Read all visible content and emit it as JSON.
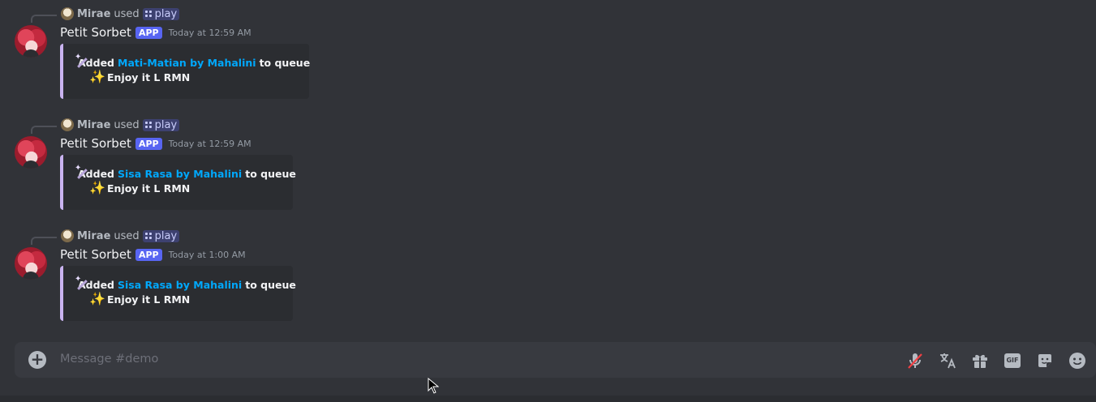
{
  "messages": [
    {
      "reply": {
        "user": "Mirae",
        "verb": "used",
        "command": "play"
      },
      "author": "Petit Sorbet",
      "badge": "APP",
      "timestamp": "Today at 12:59 AM",
      "embed": {
        "added": "Added",
        "track": "Mati-Matian by Mahalini",
        "suffix": "to queue",
        "line2": "Enjoy it L RMN"
      }
    },
    {
      "reply": {
        "user": "Mirae",
        "verb": "used",
        "command": "play"
      },
      "author": "Petit Sorbet",
      "badge": "APP",
      "timestamp": "Today at 12:59 AM",
      "embed": {
        "added": "Added",
        "track": "Sisa Rasa by Mahalini",
        "suffix": "to queue",
        "line2": "Enjoy it L RMN"
      }
    },
    {
      "reply": {
        "user": "Mirae",
        "verb": "used",
        "command": "play"
      },
      "author": "Petit Sorbet",
      "badge": "APP",
      "timestamp": "Today at 1:00 AM",
      "embed": {
        "added": "Added",
        "track": "Sisa Rasa by Mahalini",
        "suffix": "to queue",
        "line2": "Enjoy it L RMN"
      }
    }
  ],
  "composer": {
    "placeholder": "Message #demo",
    "gif_label": "GIF",
    "icons": [
      "plus-icon",
      "voice-muted-icon",
      "translate-icon",
      "gift-icon",
      "gif-icon",
      "sticker-icon",
      "emoji-icon"
    ]
  },
  "colors": {
    "bg": "#313338",
    "embed_bg": "#2b2d31",
    "embed_border": "#c9b3f0",
    "link": "#00a8fc",
    "badge": "#5865f2",
    "composer": "#383a40"
  }
}
